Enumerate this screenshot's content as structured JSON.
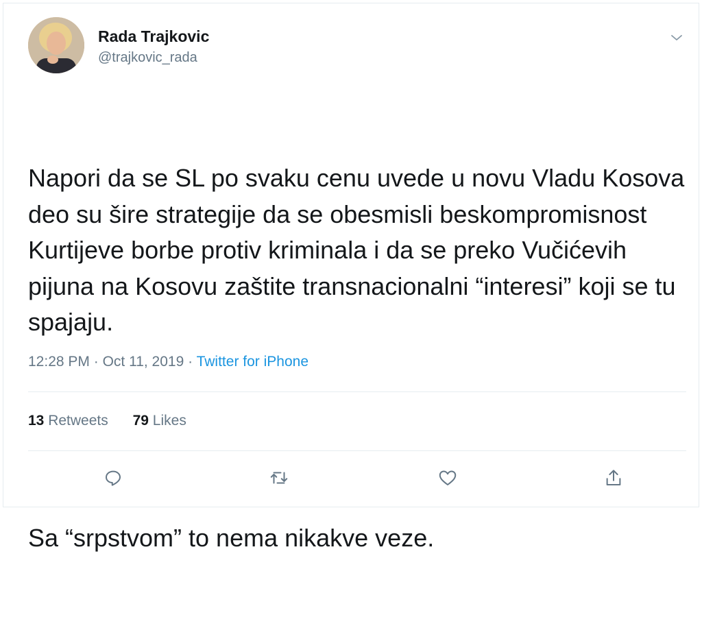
{
  "tweet": {
    "author": {
      "display_name": "Rada Trajkovic",
      "handle": "@trajkovic_rada"
    },
    "text_paragraphs": [
      "Napori da se SL po svaku cenu uvede u novu Vladu Kosova deo su šire strategije da se obesmisli beskompromisnost Kurtijeve borbe protiv kriminala i da se preko Vučićevih pijuna na Kosovu zaštite transnacionalni “interesi” koji se tu spajaju.",
      "Sa “srpstvom” to nema nikakve veze."
    ],
    "time": "12:28 PM",
    "date": "Oct 11, 2019",
    "separator": "·",
    "source": "Twitter for iPhone",
    "stats": {
      "retweets_count": "13",
      "retweets_label": "Retweets",
      "likes_count": "79",
      "likes_label": "Likes"
    },
    "icons": {
      "menu": "chevron-down-icon",
      "reply": "reply-icon",
      "retweet": "retweet-icon",
      "like": "heart-icon",
      "share": "share-icon"
    }
  },
  "colors": {
    "text": "#14171a",
    "secondary": "#657786",
    "link": "#1b95e0",
    "border": "#e6ecf0"
  }
}
